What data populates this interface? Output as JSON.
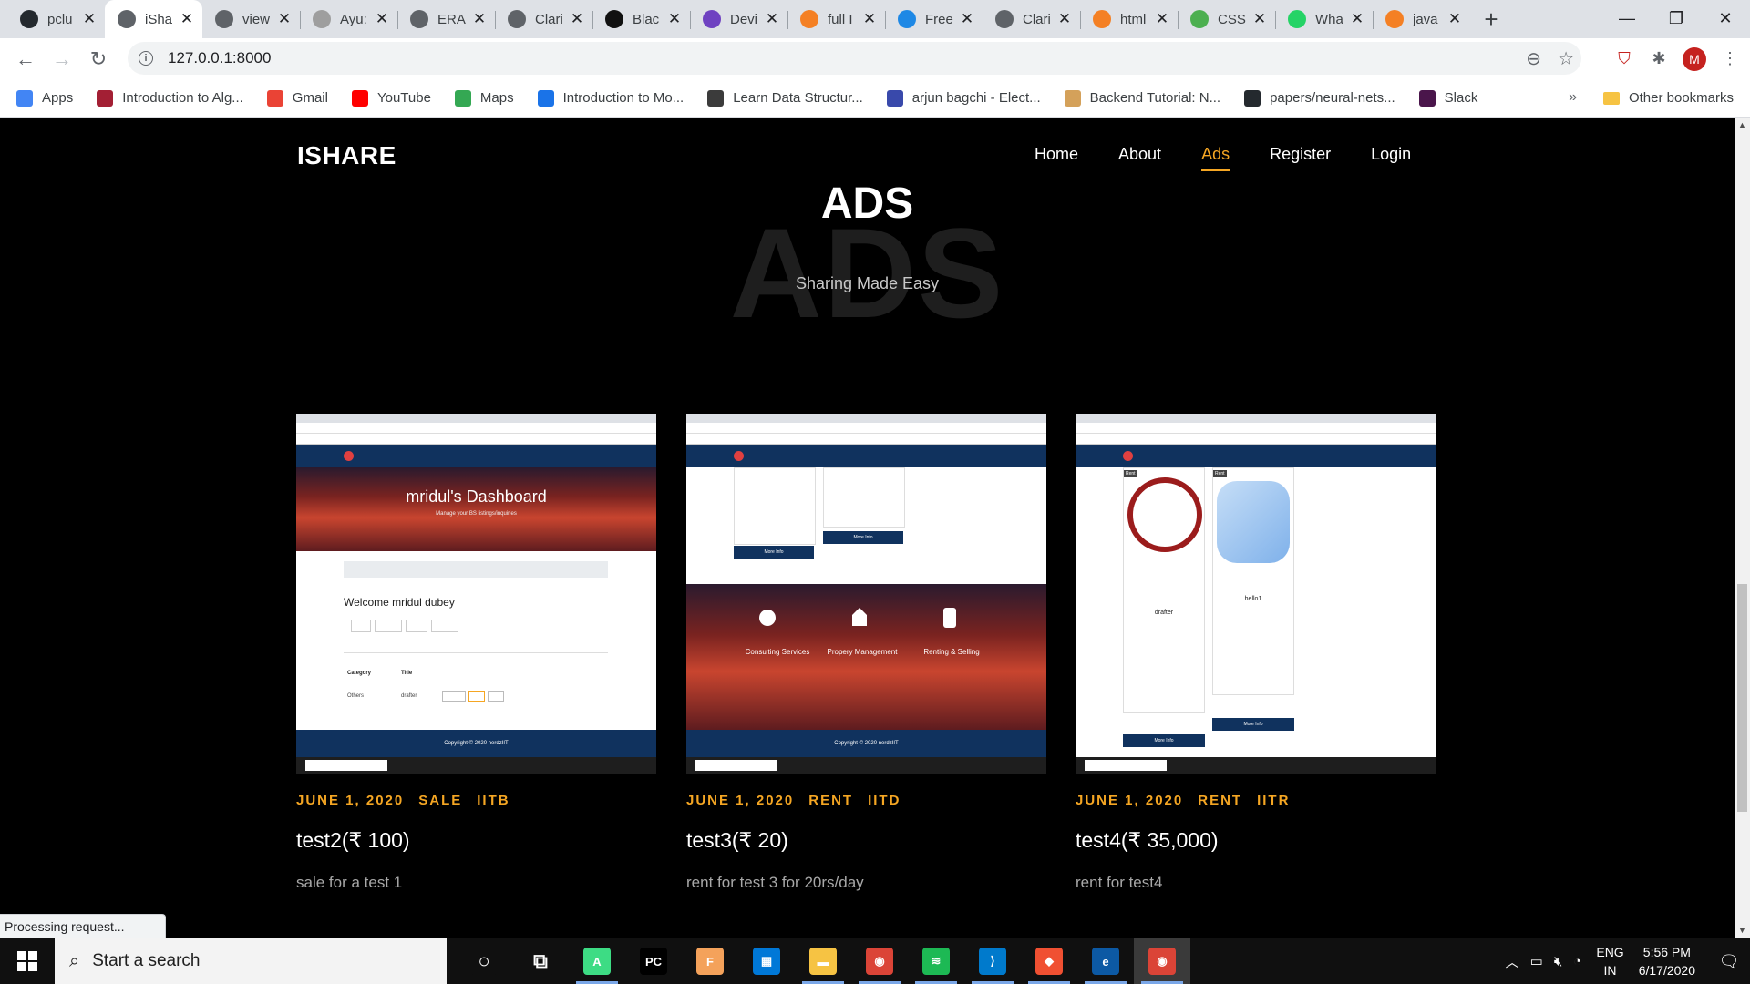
{
  "browser": {
    "tabs": [
      {
        "title": "pclu",
        "icon": "github-icon",
        "color": "#24292e"
      },
      {
        "title": "iSha",
        "icon": "globe-icon",
        "color": "#5f6368",
        "active": true
      },
      {
        "title": "view",
        "icon": "globe-icon",
        "color": "#5f6368"
      },
      {
        "title": "Ayu:",
        "icon": "x-doc-icon",
        "color": "#9e9e9e"
      },
      {
        "title": "ERA",
        "icon": "globe-icon",
        "color": "#5f6368"
      },
      {
        "title": "Clari",
        "icon": "wordpress-icon",
        "color": "#5f6368"
      },
      {
        "title": "Blac",
        "icon": "blackboard-icon",
        "color": "#111111"
      },
      {
        "title": "Devi",
        "icon": "bootstrap-icon",
        "color": "#6f42c1"
      },
      {
        "title": "full I",
        "icon": "stackoverflow-icon",
        "color": "#f48024"
      },
      {
        "title": "Free",
        "icon": "flutter-icon",
        "color": "#1e88e5"
      },
      {
        "title": "Clari",
        "icon": "globe-icon",
        "color": "#5f6368"
      },
      {
        "title": "html",
        "icon": "stackoverflow-icon",
        "color": "#f48024"
      },
      {
        "title": "CSS",
        "icon": "w3schools-icon",
        "color": "#4caf50"
      },
      {
        "title": "Wha",
        "icon": "whatsapp-icon",
        "color": "#25d366"
      },
      {
        "title": "java",
        "icon": "stackoverflow-icon",
        "color": "#f48024"
      }
    ],
    "url": "127.0.0.1:8000",
    "profile_initial": "M",
    "bookmarks": [
      {
        "label": "Apps",
        "icon": "apps-grid-icon",
        "color": "#4285f4"
      },
      {
        "label": "Introduction to Alg...",
        "icon": "mit-icon",
        "color": "#a31f34"
      },
      {
        "label": "Gmail",
        "icon": "gmail-icon",
        "color": "#ea4335"
      },
      {
        "label": "YouTube",
        "icon": "youtube-icon",
        "color": "#ff0000"
      },
      {
        "label": "Maps",
        "icon": "maps-icon",
        "color": "#34a853"
      },
      {
        "label": "Introduction to Mo...",
        "icon": "chart-icon",
        "color": "#1a73e8"
      },
      {
        "label": "Learn Data Structur...",
        "icon": "cc-icon",
        "color": "#3b3b3b"
      },
      {
        "label": "arjun bagchi - Elect...",
        "icon": "calendar-icon",
        "color": "#3949ab"
      },
      {
        "label": "Backend Tutorial: N...",
        "icon": "person-icon",
        "color": "#d4a15a"
      },
      {
        "label": "papers/neural-nets...",
        "icon": "github-icon",
        "color": "#24292e"
      },
      {
        "label": "Slack",
        "icon": "slack-icon",
        "color": "#4a154b"
      }
    ],
    "more_bookmarks": "»",
    "other_bookmarks": "Other bookmarks",
    "status_text": "Processing request..."
  },
  "site": {
    "brand": "ISHARE",
    "nav": [
      {
        "label": "Home"
      },
      {
        "label": "About"
      },
      {
        "label": "Ads",
        "active": true
      },
      {
        "label": "Register"
      },
      {
        "label": "Login"
      }
    ],
    "hero": {
      "bg_text": "ADS",
      "title": "ADS",
      "subtitle": "Sharing Made Easy"
    },
    "listings": [
      {
        "date": "JUNE 1, 2020",
        "type": "SALE",
        "college": "IITB",
        "title": "test2(₹ 100)",
        "description": "sale for a test 1"
      },
      {
        "date": "JUNE 1, 2020",
        "type": "RENT",
        "college": "IITD",
        "title": "test3(₹ 20)",
        "description": "rent for test 3 for 20rs/day"
      },
      {
        "date": "JUNE 1, 2020",
        "type": "RENT",
        "college": "IITR",
        "title": "test4(₹ 35,000)",
        "description": "rent for test4"
      }
    ],
    "thumb1": {
      "heading": "mridul's Dashboard",
      "sub": "Manage your BS listings/inquiries",
      "welcome": "Welcome mridul dubey",
      "col1": "Category",
      "col2": "Title",
      "row_cat": "Others",
      "row_title": "drafter",
      "footer": "Copyright © 2020 nerdzIIT"
    },
    "thumb2": {
      "svc1": "Consulting Services",
      "svc2": "Propery Management",
      "svc3": "Renting & Selling",
      "btn": "More Info",
      "footer": "Copyright © 2020 nerdzIIT"
    },
    "thumb3": {
      "tag1": "Rent",
      "tag2": "Rent",
      "name1": "drafter",
      "name2": "hello1",
      "btn": "More Info"
    }
  },
  "taskbar": {
    "search_placeholder": "Start a search",
    "apps": [
      {
        "name": "cortana",
        "icon": "cortana-icon",
        "color": "#101010"
      },
      {
        "name": "task-view",
        "icon": "task-view-icon",
        "color": "#101010"
      },
      {
        "name": "android-studio",
        "icon": "android-studio-icon",
        "color": "#3ddc84"
      },
      {
        "name": "pycharm",
        "icon": "pycharm-icon",
        "color": "#000000"
      },
      {
        "name": "foxit",
        "icon": "foxit-icon",
        "color": "#f4a25b"
      },
      {
        "name": "store",
        "icon": "store-icon",
        "color": "#0078d7"
      },
      {
        "name": "file-explorer",
        "icon": "folder-icon",
        "color": "#f6c343"
      },
      {
        "name": "chrome",
        "icon": "chrome-icon",
        "color": "#db4437"
      },
      {
        "name": "spotify",
        "icon": "spotify-icon",
        "color": "#1db954"
      },
      {
        "name": "vscode",
        "icon": "vscode-icon",
        "color": "#007acc"
      },
      {
        "name": "git",
        "icon": "git-icon",
        "color": "#f05032"
      },
      {
        "name": "edge",
        "icon": "edge-icon",
        "color": "#0c59a4"
      },
      {
        "name": "chrome-active",
        "icon": "chrome-icon",
        "color": "#db4437"
      }
    ],
    "lang_top": "ENG",
    "lang_bottom": "IN",
    "time": "5:56 PM",
    "date": "6/17/2020"
  }
}
